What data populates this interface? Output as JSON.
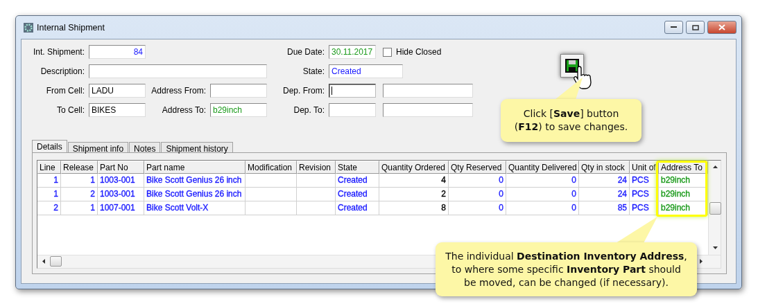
{
  "window": {
    "title": "Internal Shipment"
  },
  "form": [
    {
      "label": "Int. Shipment:",
      "value": "84",
      "color": "#1a1aff",
      "kind": "number"
    },
    {
      "label": "Due Date:",
      "value": "30.11.2017",
      "color": "#1a9a1a",
      "kind": "text"
    },
    {
      "label": "Description:",
      "kind": "wide"
    },
    {
      "label": "State:",
      "value": "Created",
      "color": "#1a1aff",
      "kind": "medium"
    },
    {
      "label": "From Cell:",
      "value": "LADU",
      "color": "#000000",
      "kind": "text"
    },
    {
      "label": "Address From:",
      "kind": "text"
    },
    {
      "label": "Dep. From:",
      "kind": "pair",
      "focused": true
    },
    {
      "label": "To Cell:",
      "value": "BIKES",
      "color": "#000000",
      "kind": "text"
    },
    {
      "label": "Address To:",
      "value": "b29inch",
      "color": "#1a9a1a",
      "kind": "text"
    },
    {
      "label": "Dep. To:",
      "kind": "pair",
      "focused": false
    }
  ],
  "hide_closed": {
    "label": "Hide Closed",
    "checked": false
  },
  "tabs": [
    {
      "label": "Details",
      "selected": true
    },
    {
      "label": "Shipment info",
      "selected": false
    },
    {
      "label": "Notes",
      "selected": false
    },
    {
      "label": "Shipment history",
      "selected": false
    }
  ],
  "table": {
    "columns": [
      {
        "label": "Line",
        "kind": "number",
        "color": "#1a1aff"
      },
      {
        "label": "Release",
        "kind": "number",
        "color": "#1a1aff"
      },
      {
        "label": "Part No",
        "kind": "text",
        "color": "#1a1aff"
      },
      {
        "label": "Part name",
        "kind": "text",
        "color": "#1a1aff"
      },
      {
        "label": "Modification",
        "kind": "text"
      },
      {
        "label": "Revision",
        "kind": "text"
      },
      {
        "label": "State",
        "kind": "text",
        "color": "#1a1aff"
      },
      {
        "label": "Quantity Ordered",
        "kind": "number",
        "color": "#000000"
      },
      {
        "label": "Qty Reserved",
        "kind": "number",
        "color": "#1a1aff"
      },
      {
        "label": "Quantity Delivered",
        "kind": "number",
        "color": "#1a1aff"
      },
      {
        "label": "Qty in stock",
        "kind": "number",
        "color": "#1a1aff"
      },
      {
        "label": "Unit of",
        "kind": "text",
        "color": "#1a1aff"
      },
      {
        "label": "Address To",
        "kind": "text",
        "color": "#1a9a1a"
      }
    ],
    "rows": [
      [
        "1",
        "1",
        "1003-001",
        "Bike Scott Genius 26 inch",
        null,
        null,
        "Created",
        "4",
        "0",
        "0",
        "24",
        "PCS",
        "b29inch"
      ],
      [
        "1",
        "2",
        "1003-001",
        "Bike Scott Genius 26 inch",
        null,
        null,
        "Created",
        "2",
        "0",
        "0",
        "24",
        "PCS",
        "b29inch"
      ],
      [
        "2",
        "1",
        "1007-001",
        "Bike Scott Volt-X",
        null,
        null,
        "Created",
        "8",
        "0",
        "0",
        "85",
        "PCS",
        "b29inch"
      ]
    ]
  },
  "callouts": [
    {
      "kind": "save",
      "text": "Click [**Save**] button (**F12**) to save changes."
    },
    {
      "kind": "address",
      "text": "The individual **Destination Inventory Address**, to where some specific **Inventory Part** should be moved, can be changed (if necessary)."
    }
  ]
}
